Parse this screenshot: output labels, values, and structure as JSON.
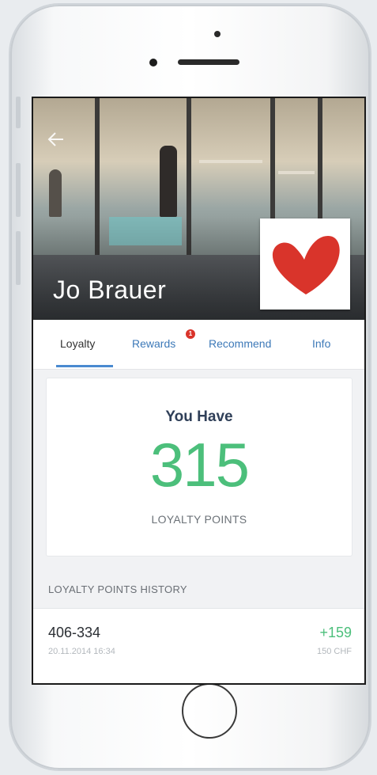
{
  "header": {
    "store_name": "Jo Brauer",
    "back_icon": "back-arrow-icon",
    "logo_icon": "heart-icon",
    "logo_color": "#d9342b"
  },
  "tabs": [
    {
      "label": "Loyalty",
      "active": true
    },
    {
      "label": "Rewards",
      "badge": "1"
    },
    {
      "label": "Recommend"
    },
    {
      "label": "Info"
    }
  ],
  "points_card": {
    "heading": "You Have",
    "value": "315",
    "label": "LOYALTY POINTS",
    "accent": "#4cbf7b"
  },
  "history": {
    "title": "LOYALTY POINTS HISTORY",
    "rows": [
      {
        "code": "406-334",
        "date": "20.11.2014 16:34",
        "delta": "+159",
        "amount": "150 CHF"
      }
    ]
  }
}
